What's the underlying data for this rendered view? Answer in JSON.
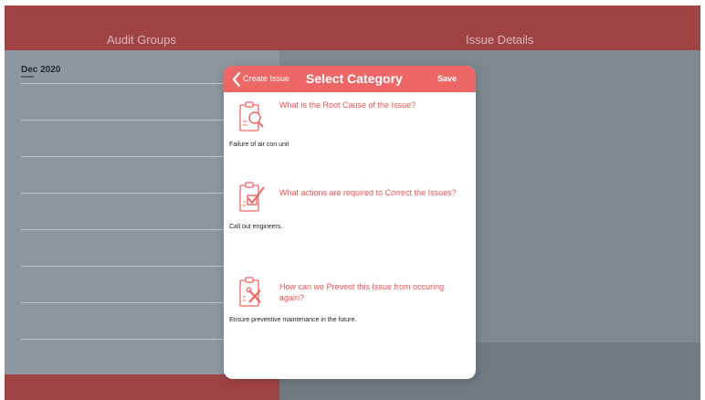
{
  "background": {
    "header": {
      "left_title": "Audit Groups",
      "right_title": "Issue Details"
    },
    "groups": [
      {
        "title": "Dec 2020",
        "subtitle": ""
      }
    ]
  },
  "modal": {
    "back_label": "Create Issue",
    "title": "Select Category",
    "save_label": "Save",
    "questions": [
      {
        "question": "What is the Root Cause of the Issue?",
        "answer": "Failure of air con unit",
        "icon": "clipboard-magnifier-icon"
      },
      {
        "question": "What actions are required to Correct the Issues?",
        "answer": "Call out engineers.",
        "icon": "clipboard-check-icon"
      },
      {
        "question": "How can we Prevent this Issue from occuring again?",
        "answer": "Ensure preventive maintenance in the future.",
        "icon": "clipboard-tools-icon"
      }
    ]
  },
  "colors": {
    "accent": "#ec6766",
    "header_bg": "#a04345",
    "pane_bg": "#8c979f"
  }
}
